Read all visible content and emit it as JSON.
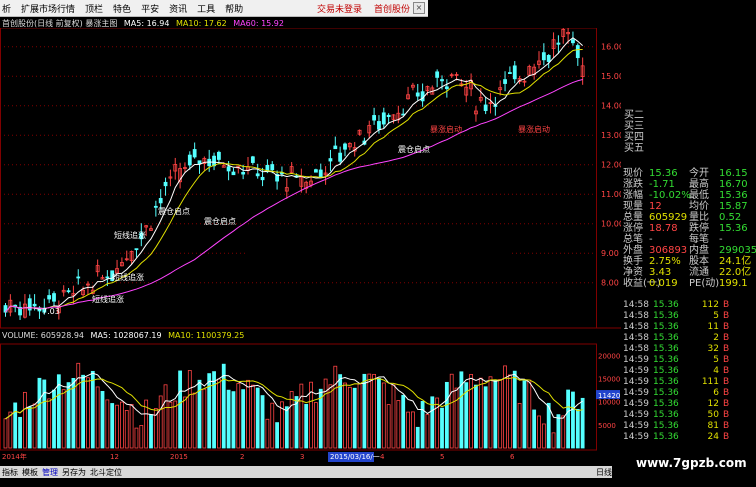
{
  "menu": {
    "items": [
      "析",
      "扩展市场行情",
      "顶栏",
      "特色",
      "平安",
      "资讯",
      "工具",
      "帮助"
    ],
    "trade_login": "交易未登录",
    "broker": "首创股份"
  },
  "chart_header": {
    "title": "首创股份(日线 前复权) 暴涨主图",
    "ma5_label": "MA5: 16.94",
    "ma10_label": "MA10: 17.62",
    "ma60_label": "MA60: 15.92"
  },
  "price_axis": {
    "ticks": [
      "16.00",
      "15.00",
      "14.00",
      "13.00",
      "12.00",
      "11.00",
      "10.00",
      "9.00",
      "8.00"
    ]
  },
  "annotations": [
    "震仓启点",
    "震仓启点",
    "短线追涨",
    "短线追涨",
    "短线追涨",
    "震仓启点",
    "暴涨启动",
    "暴涨启动",
    "7.03"
  ],
  "volume_header": {
    "volume_label": "VOLUME: 605928.94",
    "ma5_label": "MA5: 1028067.19",
    "ma10_label": "MA10: 1100379.25"
  },
  "volume_axis": {
    "ticks": [
      "20000",
      "15000",
      "11420",
      "10000",
      "5000"
    ]
  },
  "date_axis": {
    "labels": [
      "2014年",
      "12",
      "2015",
      "2",
      "3",
      "4",
      "5",
      "6"
    ],
    "crosshair_date": "2015/03/16/一"
  },
  "order_book": [
    "买二",
    "买三",
    "买四",
    "买五"
  ],
  "quote": [
    {
      "k1": "现价",
      "v1": "15.36",
      "k2": "今开",
      "v2": "16.15",
      "c1": "#33dd33",
      "c2": "#33dd33"
    },
    {
      "k1": "涨跌",
      "v1": "-1.71",
      "k2": "最高",
      "v2": "16.70",
      "c1": "#33dd33",
      "c2": "#33dd33"
    },
    {
      "k1": "涨幅",
      "v1": "-10.02%",
      "k2": "最低",
      "v2": "15.36",
      "c1": "#33dd33",
      "c2": "#33dd33"
    },
    {
      "k1": "现量",
      "v1": "12",
      "k2": "均价",
      "v2": "15.87",
      "c1": "#ff4444",
      "c2": "#33dd33"
    },
    {
      "k1": "总量",
      "v1": "605929",
      "k2": "量比",
      "v2": "0.52",
      "c1": "#e0e000",
      "c2": "#33dd33"
    },
    {
      "k1": "涨停",
      "v1": "18.78",
      "k2": "跌停",
      "v2": "15.36",
      "c1": "#ff4444",
      "c2": "#33dd33"
    },
    {
      "k1": "总笔",
      "v1": "-",
      "k2": "每笔",
      "v2": "-",
      "c1": "#cccccc",
      "c2": "#cccccc"
    },
    {
      "k1": "外盘",
      "v1": "306893",
      "k2": "内盘",
      "v2": "299035",
      "c1": "#ff4444",
      "c2": "#33dd33"
    },
    {
      "k1": "换手",
      "v1": "2.75%",
      "k2": "股本",
      "v2": "24.1亿",
      "c1": "#e0e000",
      "c2": "#e0e000"
    },
    {
      "k1": "净资",
      "v1": "3.43",
      "k2": "流通",
      "v2": "22.0亿",
      "c1": "#e0e000",
      "c2": "#e0e000"
    },
    {
      "k1": "收益(一)",
      "v1": "0.019",
      "k2": "PE(动)",
      "v2": "199.1",
      "c1": "#e0e000",
      "c2": "#e0e000"
    }
  ],
  "ticks_table": [
    {
      "t": "14:58",
      "p": "15.36",
      "v": "112",
      "s": "B"
    },
    {
      "t": "14:58",
      "p": "15.36",
      "v": "5",
      "s": "B"
    },
    {
      "t": "14:58",
      "p": "15.36",
      "v": "11",
      "s": "B"
    },
    {
      "t": "14:58",
      "p": "15.36",
      "v": "2",
      "s": "B"
    },
    {
      "t": "14:58",
      "p": "15.36",
      "v": "32",
      "s": "B"
    },
    {
      "t": "14:59",
      "p": "15.36",
      "v": "5",
      "s": "B"
    },
    {
      "t": "14:59",
      "p": "15.36",
      "v": "4",
      "s": "B"
    },
    {
      "t": "14:59",
      "p": "15.36",
      "v": "111",
      "s": "B"
    },
    {
      "t": "14:59",
      "p": "15.36",
      "v": "6",
      "s": "B"
    },
    {
      "t": "14:59",
      "p": "15.36",
      "v": "12",
      "s": "B"
    },
    {
      "t": "14:59",
      "p": "15.36",
      "v": "50",
      "s": "B"
    },
    {
      "t": "14:59",
      "p": "15.36",
      "v": "81",
      "s": "B"
    },
    {
      "t": "14:59",
      "p": "15.36",
      "v": "24",
      "s": "B"
    }
  ],
  "bottom_bar": {
    "indicator": "指标",
    "template": "模板",
    "manage": "管理",
    "save_as": "另存为",
    "locate": "北斗定位",
    "day": "日线"
  },
  "watermark": "www.7gpzb.com",
  "colors": {
    "up": "#ff4444",
    "down": "#55ffff",
    "ma5": "#ffffff",
    "ma10": "#e0e000",
    "ma60": "#ff44ff",
    "grid": "#800000"
  }
}
